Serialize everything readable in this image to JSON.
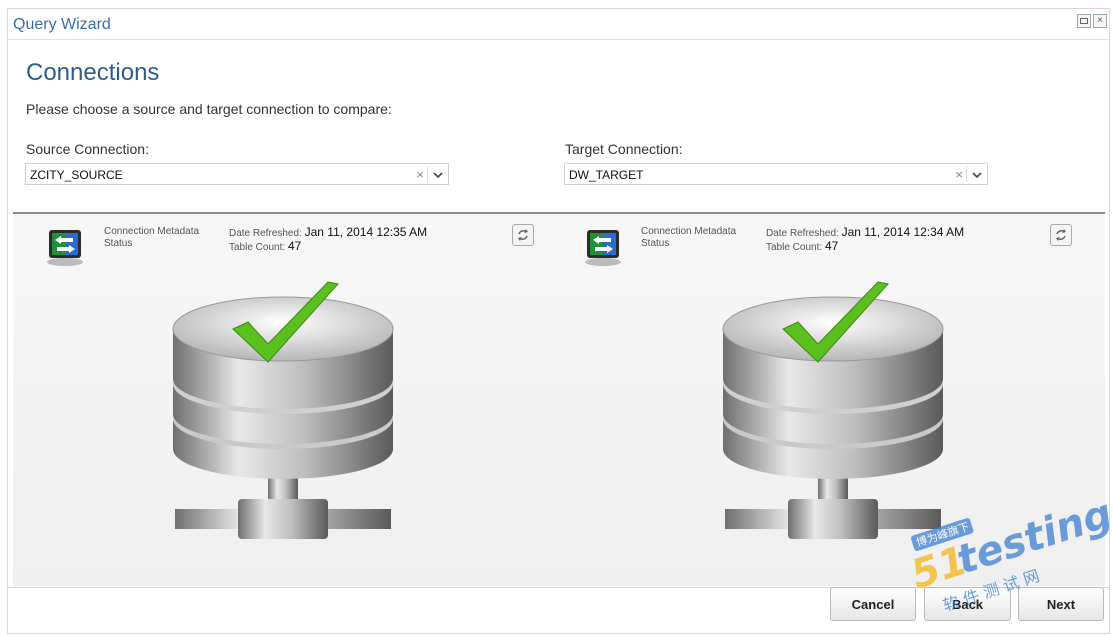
{
  "window": {
    "title": "Query Wizard"
  },
  "page": {
    "heading": "Connections",
    "prompt": "Please choose a source and target connection to compare:"
  },
  "source": {
    "label": "Source Connection:",
    "value": "ZCITY_SOURCE",
    "metadata_label": "Connection Metadata\nStatus",
    "date_refreshed_label": "Date Refreshed:",
    "date_refreshed": "Jan 11, 2014 12:35 AM",
    "table_count_label": "Table Count:",
    "table_count": "47"
  },
  "target": {
    "label": "Target Connection:",
    "value": "DW_TARGET",
    "metadata_label": "Connection Metadata\nStatus",
    "date_refreshed_label": "Date Refreshed:",
    "date_refreshed": "Jan 11, 2014 12:34 AM",
    "table_count_label": "Table Count:",
    "table_count": "47"
  },
  "footer": {
    "cancel_label": "Cancel",
    "back_label": "Back",
    "next_label": "Next"
  },
  "watermark": {
    "brand": "51testing",
    "sub": "软 件 测 试 网",
    "tag": "博为峰旗下"
  },
  "colors": {
    "accent": "#3a6ea5",
    "check": "#5bbf1f"
  }
}
